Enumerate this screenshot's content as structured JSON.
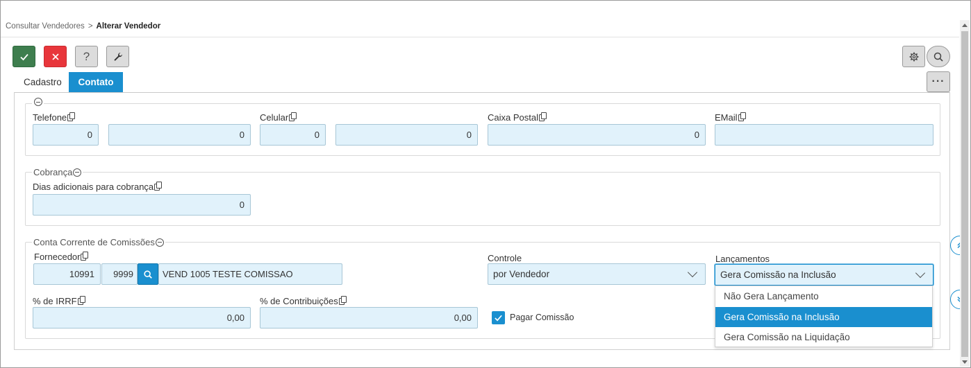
{
  "breadcrumb": {
    "parent": "Consultar Vendedores",
    "separator": ">",
    "current": "Alterar Vendedor"
  },
  "tabs": [
    {
      "label": "Cadastro",
      "active": false
    },
    {
      "label": "Contato",
      "active": true
    }
  ],
  "toolbar": {
    "help_label": "?",
    "more_label": "···"
  },
  "contato": {
    "telefone": {
      "label": "Telefone",
      "ddd": "0",
      "numero": "0"
    },
    "celular": {
      "label": "Celular",
      "ddd": "0",
      "numero": "0"
    },
    "caixa_postal": {
      "label": "Caixa Postal",
      "value": "0"
    },
    "email": {
      "label": "EMail",
      "value": ""
    }
  },
  "cobranca": {
    "legend": "Cobrança",
    "dias_adicionais": {
      "label": "Dias adicionais para cobrança",
      "value": "0"
    }
  },
  "comissoes": {
    "legend": "Conta Corrente de Comissões",
    "fornecedor": {
      "label": "Fornecedor",
      "codigo": "10991",
      "loja": "9999",
      "nome": "VEND 1005 TESTE COMISSAO"
    },
    "controle": {
      "label": "Controle",
      "value": "por Vendedor"
    },
    "lancamentos": {
      "label": "Lançamentos",
      "value": "Gera Comissão na Inclusão",
      "options": [
        "Não Gera Lançamento",
        "Gera Comissão na Inclusão",
        "Gera Comissão na Liquidação"
      ],
      "selected_index": 1
    },
    "irrf": {
      "label": "% de IRRF",
      "value": "0,00"
    },
    "contribuicoes": {
      "label": "% de Contribuições",
      "value": "0,00"
    },
    "pagar_comissao": {
      "label": "Pagar Comissão",
      "checked": true
    }
  },
  "colors": {
    "accent": "#1a8fcf",
    "confirm": "#3e7e4e",
    "cancel": "#e8363b",
    "input_bg": "#e1f2fb"
  }
}
